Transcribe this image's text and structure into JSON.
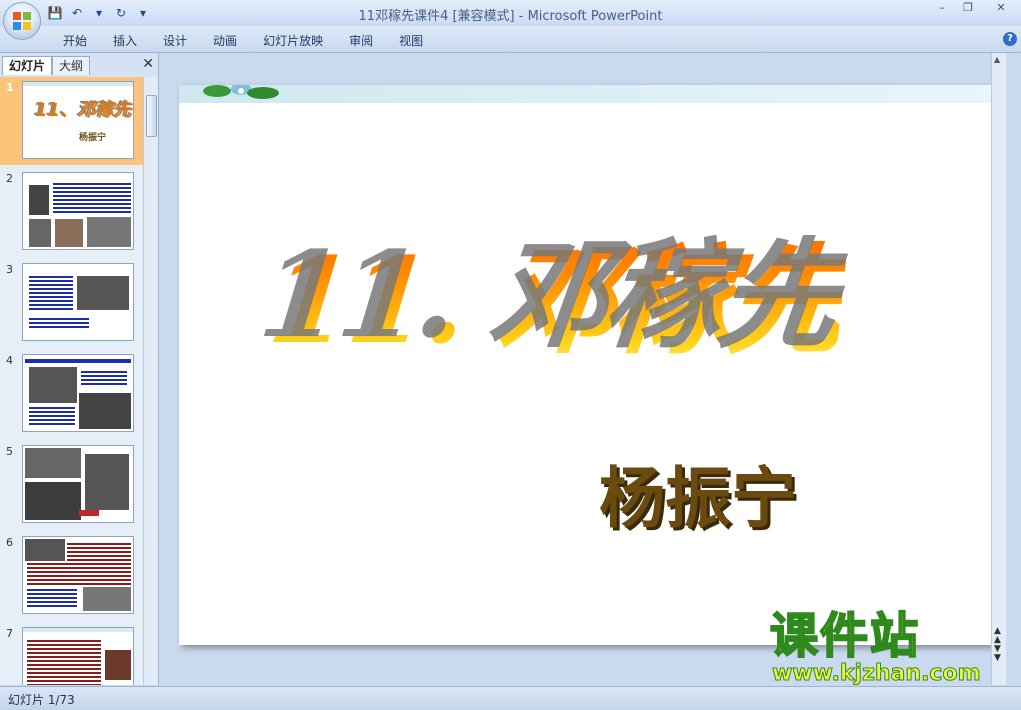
{
  "window": {
    "title": "11邓稼先课件4 [兼容模式] - Microsoft PowerPoint",
    "controls": {
      "minimize": "–",
      "restore": "❐",
      "close": "✕"
    }
  },
  "quick_access": [
    {
      "icon": "save-icon",
      "glyph": "💾"
    },
    {
      "icon": "undo-icon",
      "glyph": "↶"
    },
    {
      "icon": "dropdown-icon",
      "glyph": "▾"
    },
    {
      "icon": "redo-icon",
      "glyph": "↻"
    },
    {
      "icon": "customize-icon",
      "glyph": "▾"
    }
  ],
  "ribbon": {
    "tabs": [
      "开始",
      "插入",
      "设计",
      "动画",
      "幻灯片放映",
      "审阅",
      "视图"
    ],
    "help": "?"
  },
  "left_pane": {
    "tabs": [
      "幻灯片",
      "大纲"
    ],
    "close": "✕",
    "slides": [
      {
        "num": "1",
        "selected": true
      },
      {
        "num": "2"
      },
      {
        "num": "3"
      },
      {
        "num": "4"
      },
      {
        "num": "5"
      },
      {
        "num": "6"
      },
      {
        "num": "7"
      }
    ],
    "thumb1": {
      "title": "11、邓稼先",
      "author": "杨振宁"
    }
  },
  "slide": {
    "title": "11. 邓稼先",
    "author": "杨振宁"
  },
  "watermark": {
    "brand": "课件站",
    "url": "www.kjzhan.com"
  },
  "status": {
    "slide_counter": "幻灯片 1/73"
  }
}
